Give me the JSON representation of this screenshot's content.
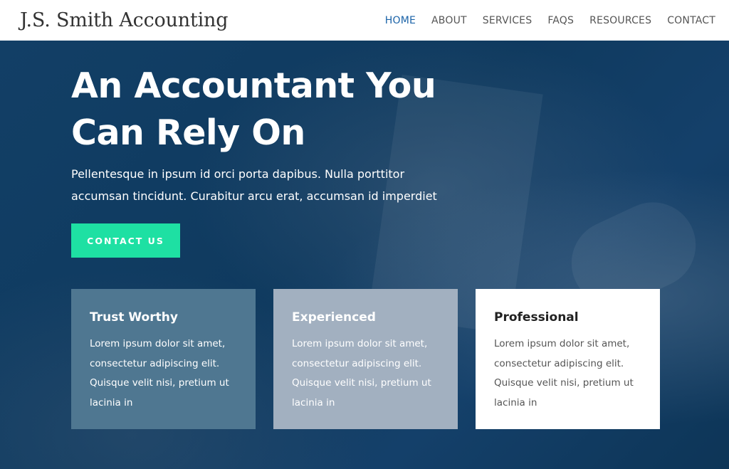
{
  "header": {
    "logo": "J.S. Smith Accounting",
    "nav": [
      {
        "label": "HOME",
        "active": true
      },
      {
        "label": "ABOUT",
        "active": false
      },
      {
        "label": "SERVICES",
        "active": false
      },
      {
        "label": "FAQS",
        "active": false
      },
      {
        "label": "RESOURCES",
        "active": false
      },
      {
        "label": "CONTACT",
        "active": false
      }
    ]
  },
  "hero": {
    "title_line1": "An Accountant You",
    "title_line2": "Can Rely On",
    "subtitle_line1": "Pellentesque in ipsum id orci porta dapibus. Nulla porttitor",
    "subtitle_line2": "accumsan tincidunt. Curabitur arcu erat, accumsan id imperdiet",
    "cta_label": "CONTACT US"
  },
  "cards": [
    {
      "title": "Trust Worthy",
      "lines": [
        "Lorem ipsum dolor sit amet,",
        "consectetur adipiscing elit.",
        "Quisque velit nisi, pretium ut",
        "lacinia in"
      ]
    },
    {
      "title": "Experienced",
      "lines": [
        "Lorem ipsum dolor sit amet,",
        "consectetur adipiscing elit.",
        "Quisque velit nisi, pretium ut",
        "lacinia in"
      ]
    },
    {
      "title": "Professional",
      "lines": [
        "Lorem ipsum dolor sit amet,",
        "consectetur adipiscing elit.",
        "Quisque velit nisi, pretium ut",
        "lacinia in"
      ]
    }
  ],
  "colors": {
    "nav_active": "#1b63a8",
    "cta": "#1ee0a3",
    "hero_bg": "#0f3a5f",
    "card_1": "#4f7791",
    "card_2": "#a2b0c0",
    "card_3": "#ffffff"
  }
}
